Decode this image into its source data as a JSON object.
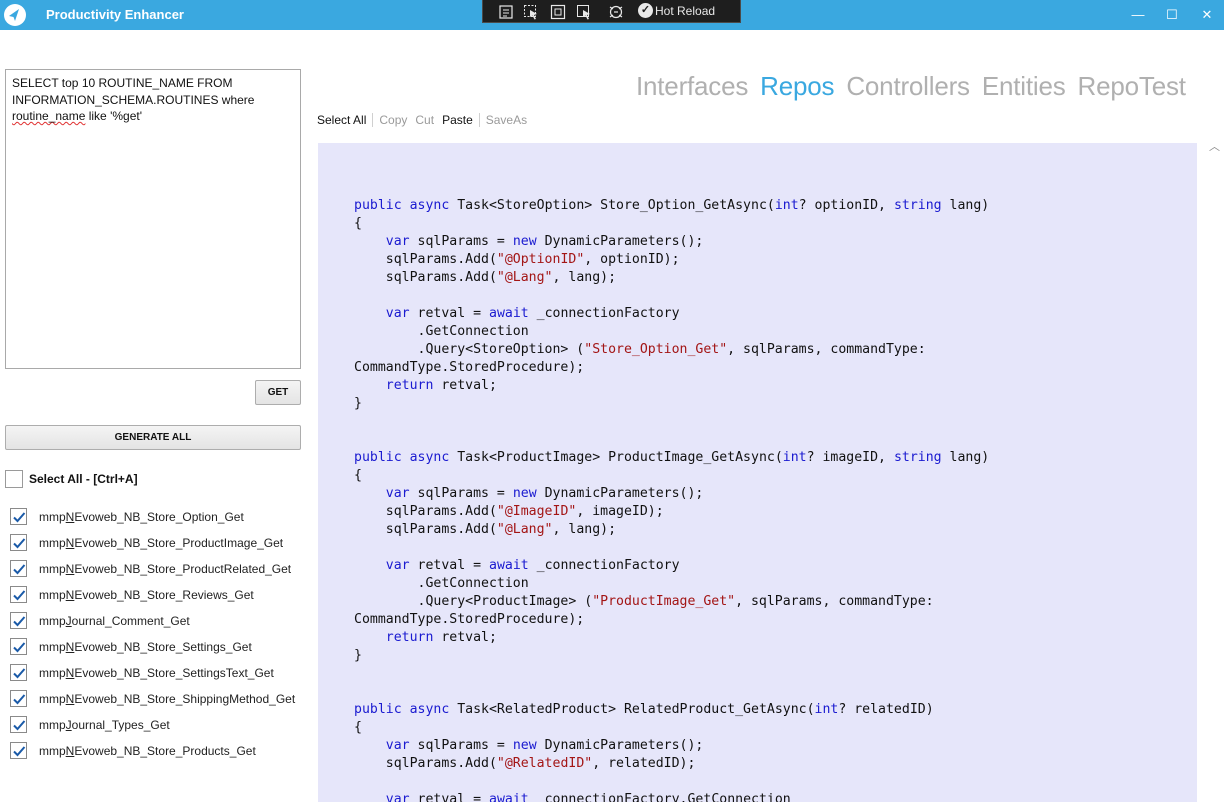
{
  "window": {
    "title": "Productivity Enhancer",
    "controls": {
      "minimize": "—",
      "maximize": "☐",
      "close": "✕"
    }
  },
  "devbar": {
    "hot_reload_label": "Hot Reload",
    "icons": [
      "live-visual-tree-icon",
      "select-element-icon",
      "display-layout-adorners-icon",
      "track-focus-icon",
      "binding-failures-icon",
      "hot-reload-check-icon"
    ]
  },
  "query": {
    "sql_line1": "SELECT top 10 ROUTINE_NAME FROM",
    "sql_line2": "INFORMATION_SCHEMA.ROUTINES where",
    "sql_line3_word": "routine_name",
    "sql_line3_rest": " like '%get'"
  },
  "buttons": {
    "get": "GET",
    "generate_all": "GENERATE ALL"
  },
  "select_all_label": "Select All - [Ctrl+A]",
  "routines": [
    {
      "prefix": "mmp",
      "accel": "N",
      "rest": "Evoweb_NB_Store_Option_Get",
      "checked": true
    },
    {
      "prefix": "mmp",
      "accel": "N",
      "rest": "Evoweb_NB_Store_ProductImage_Get",
      "checked": true
    },
    {
      "prefix": "mmp",
      "accel": "N",
      "rest": "Evoweb_NB_Store_ProductRelated_Get",
      "checked": true
    },
    {
      "prefix": "mmp",
      "accel": "N",
      "rest": "Evoweb_NB_Store_Reviews_Get",
      "checked": true
    },
    {
      "prefix": "mmp",
      "accel": "J",
      "rest": "ournal_Comment_Get",
      "checked": true
    },
    {
      "prefix": "mmp",
      "accel": "N",
      "rest": "Evoweb_NB_Store_Settings_Get",
      "checked": true
    },
    {
      "prefix": "mmp",
      "accel": "N",
      "rest": "Evoweb_NB_Store_SettingsText_Get",
      "checked": true
    },
    {
      "prefix": "mmp",
      "accel": "N",
      "rest": "Evoweb_NB_Store_ShippingMethod_Get",
      "checked": true
    },
    {
      "prefix": "mmp",
      "accel": "J",
      "rest": "ournal_Types_Get",
      "checked": true
    },
    {
      "prefix": "mmp",
      "accel": "N",
      "rest": "Evoweb_NB_Store_Products_Get",
      "checked": true
    }
  ],
  "tabs": [
    {
      "label": "Interfaces",
      "active": false
    },
    {
      "label": "Repos",
      "active": true
    },
    {
      "label": "Controllers",
      "active": false
    },
    {
      "label": "Entities",
      "active": false
    },
    {
      "label": "RepoTest",
      "active": false
    }
  ],
  "edit_toolbar": {
    "select_all": "Select All",
    "copy": "Copy",
    "cut": "Cut",
    "paste": "Paste",
    "save_as": "SaveAs"
  },
  "colors": {
    "titlebar": "#3aa8e0",
    "active_tab": "#3aa8e0",
    "inactive_tab": "#b0b0b0",
    "code_background": "#e6e6fa",
    "keyword": "#1a1ad0",
    "string": "#a31515"
  },
  "code_lines": [
    [],
    [
      [
        "k",
        "public"
      ],
      [
        "t",
        " "
      ],
      [
        "k",
        "async"
      ],
      [
        "t",
        " Task<StoreOption> Store_Option_GetAsync("
      ],
      [
        "k",
        "int"
      ],
      [
        "t",
        "? optionID, "
      ],
      [
        "k",
        "string"
      ],
      [
        "t",
        " lang)"
      ]
    ],
    [
      [
        "t",
        "{"
      ]
    ],
    [
      [
        "t",
        "    "
      ],
      [
        "k",
        "var"
      ],
      [
        "t",
        " sqlParams = "
      ],
      [
        "k",
        "new"
      ],
      [
        "t",
        " DynamicParameters();"
      ]
    ],
    [
      [
        "t",
        "    sqlParams.Add("
      ],
      [
        "s",
        "\"@OptionID\""
      ],
      [
        "t",
        ", optionID);"
      ]
    ],
    [
      [
        "t",
        "    sqlParams.Add("
      ],
      [
        "s",
        "\"@Lang\""
      ],
      [
        "t",
        ", lang);"
      ]
    ],
    [],
    [
      [
        "t",
        "    "
      ],
      [
        "k",
        "var"
      ],
      [
        "t",
        " retval = "
      ],
      [
        "k",
        "await"
      ],
      [
        "t",
        " _connectionFactory"
      ]
    ],
    [
      [
        "t",
        "        .GetConnection"
      ]
    ],
    [
      [
        "t",
        "        .Query<StoreOption> ("
      ],
      [
        "s",
        "\"Store_Option_Get\""
      ],
      [
        "t",
        ", sqlParams, commandType:"
      ]
    ],
    [
      [
        "t",
        "CommandType.StoredProcedure);"
      ]
    ],
    [
      [
        "t",
        "    "
      ],
      [
        "k",
        "return"
      ],
      [
        "t",
        " retval;"
      ]
    ],
    [
      [
        "t",
        "}"
      ]
    ],
    [],
    [],
    [
      [
        "k",
        "public"
      ],
      [
        "t",
        " "
      ],
      [
        "k",
        "async"
      ],
      [
        "t",
        " Task<ProductImage> ProductImage_GetAsync("
      ],
      [
        "k",
        "int"
      ],
      [
        "t",
        "? imageID, "
      ],
      [
        "k",
        "string"
      ],
      [
        "t",
        " lang)"
      ]
    ],
    [
      [
        "t",
        "{"
      ]
    ],
    [
      [
        "t",
        "    "
      ],
      [
        "k",
        "var"
      ],
      [
        "t",
        " sqlParams = "
      ],
      [
        "k",
        "new"
      ],
      [
        "t",
        " DynamicParameters();"
      ]
    ],
    [
      [
        "t",
        "    sqlParams.Add("
      ],
      [
        "s",
        "\"@ImageID\""
      ],
      [
        "t",
        ", imageID);"
      ]
    ],
    [
      [
        "t",
        "    sqlParams.Add("
      ],
      [
        "s",
        "\"@Lang\""
      ],
      [
        "t",
        ", lang);"
      ]
    ],
    [],
    [
      [
        "t",
        "    "
      ],
      [
        "k",
        "var"
      ],
      [
        "t",
        " retval = "
      ],
      [
        "k",
        "await"
      ],
      [
        "t",
        " _connectionFactory"
      ]
    ],
    [
      [
        "t",
        "        .GetConnection"
      ]
    ],
    [
      [
        "t",
        "        .Query<ProductImage> ("
      ],
      [
        "s",
        "\"ProductImage_Get\""
      ],
      [
        "t",
        ", sqlParams, commandType:"
      ]
    ],
    [
      [
        "t",
        "CommandType.StoredProcedure);"
      ]
    ],
    [
      [
        "t",
        "    "
      ],
      [
        "k",
        "return"
      ],
      [
        "t",
        " retval;"
      ]
    ],
    [
      [
        "t",
        "}"
      ]
    ],
    [],
    [],
    [
      [
        "k",
        "public"
      ],
      [
        "t",
        " "
      ],
      [
        "k",
        "async"
      ],
      [
        "t",
        " Task<RelatedProduct> RelatedProduct_GetAsync("
      ],
      [
        "k",
        "int"
      ],
      [
        "t",
        "? relatedID)"
      ]
    ],
    [
      [
        "t",
        "{"
      ]
    ],
    [
      [
        "t",
        "    "
      ],
      [
        "k",
        "var"
      ],
      [
        "t",
        " sqlParams = "
      ],
      [
        "k",
        "new"
      ],
      [
        "t",
        " DynamicParameters();"
      ]
    ],
    [
      [
        "t",
        "    sqlParams.Add("
      ],
      [
        "s",
        "\"@RelatedID\""
      ],
      [
        "t",
        ", relatedID);"
      ]
    ],
    [],
    [
      [
        "t",
        "    "
      ],
      [
        "k",
        "var"
      ],
      [
        "t",
        " retval = "
      ],
      [
        "k",
        "await"
      ],
      [
        "t",
        " _connectionFactory.GetConnection"
      ]
    ]
  ]
}
